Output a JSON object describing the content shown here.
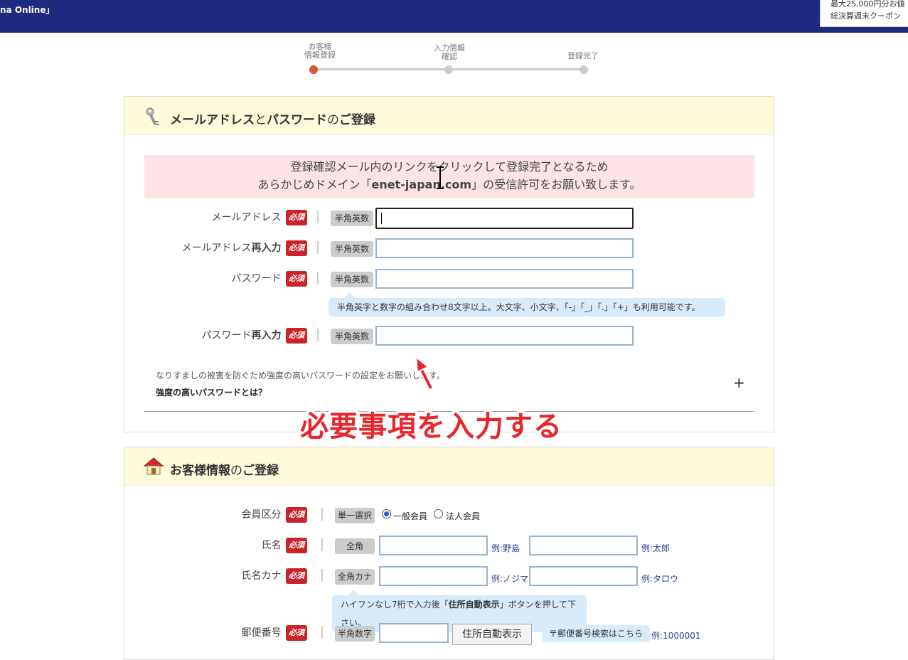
{
  "header": {
    "site_title": "na Online」",
    "promo_line1": "最大25,000円分お値",
    "promo_line2": "総決算週末クーポン"
  },
  "steps": [
    {
      "line1": "お客様",
      "line2": "情報登録"
    },
    {
      "line1": "入力情報",
      "line2": "確認"
    },
    {
      "line1": "登録完了",
      "line2": ""
    }
  ],
  "section1": {
    "title_a": "メールアドレス",
    "title_b": "と",
    "title_c": "パスワード",
    "title_d": "の",
    "title_e": "ご登録",
    "notice_line1": "登録確認メール内のリンクをクリックして登録完了となるため",
    "notice_line2_a": "あらかじめドメイン「",
    "notice_line2_b": "enet-japan.com",
    "notice_line2_c": "」の受信許可をお願い致します。",
    "required": "必須",
    "fields": [
      {
        "label": "メールアドレス",
        "label_b": "",
        "tag": "半角英数"
      },
      {
        "label": "メールアドレス",
        "label_b": "再入力",
        "tag": "半角英数"
      },
      {
        "label": "パスワード",
        "label_b": "",
        "tag": "半角英数"
      },
      {
        "label": "パスワード",
        "label_b": "再入力",
        "tag": "半角英数"
      }
    ],
    "password_tip": "半角英字と数字の組み合わせ8文字以上。大文字、小文字、「-」「_」「.」「+」も利用可能です。",
    "strong_note": "なりすましの被害を防ぐため強度の高いパスワードの設定をお願いします。",
    "strong_link": "強度の高いパスワードとは？",
    "expand": "+"
  },
  "overlay_text": "必要事項を入力する",
  "section2": {
    "title_a": "お客様情報",
    "title_b": "の",
    "title_c": "ご登録",
    "member_label": "会員区分",
    "member_tag": "単一選択",
    "opt1": "一般会員",
    "opt2": "法人会員",
    "name_label": "氏名",
    "name_tag": "全角",
    "name_ex1": "例:野島",
    "name_ex2": "例:太郎",
    "kana_label": "氏名カナ",
    "kana_tag": "全角カナ",
    "kana_ex1": "例:ノジマ",
    "kana_ex2": "例:タロウ",
    "zip_tip_a": "ハイフンなし7桁で入力後「",
    "zip_tip_b": "住所自動表示",
    "zip_tip_c": "」ボタンを押して下さい。",
    "zip_label": "郵便番号",
    "zip_tag": "半角数字",
    "zip_button": "住所自動表示",
    "zip_search": "〒郵便番号検索はこちら",
    "zip_ex": "例:1000001"
  }
}
